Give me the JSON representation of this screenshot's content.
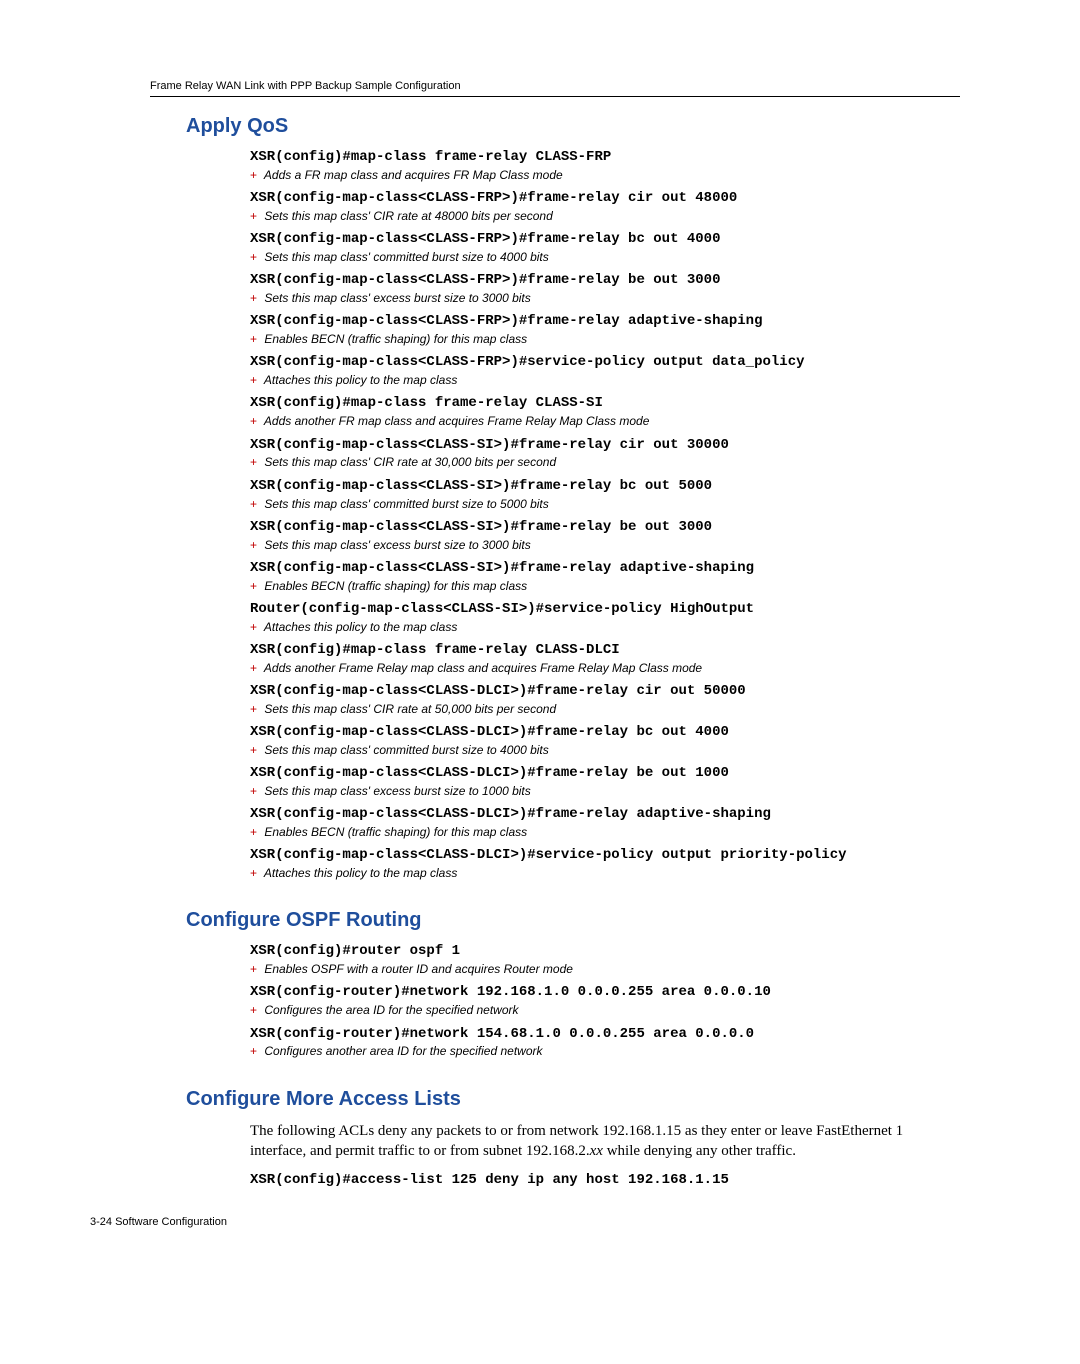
{
  "runner": "Frame Relay WAN Link with PPP Backup Sample Configuration",
  "sections": {
    "qos": {
      "title": "Apply QoS",
      "items": [
        {
          "cmd": "XSR(config)#map-class frame-relay CLASS-FRP",
          "anno": "Adds a FR map class and acquires FR Map Class mode"
        },
        {
          "cmd": "XSR(config-map-class<CLASS-FRP>)#frame-relay cir out 48000",
          "anno": "Sets this map class' CIR rate at 48000 bits per second"
        },
        {
          "cmd": "XSR(config-map-class<CLASS-FRP>)#frame-relay bc out 4000",
          "anno": "Sets this map class' committed burst size to 4000 bits"
        },
        {
          "cmd": "XSR(config-map-class<CLASS-FRP>)#frame-relay be out 3000",
          "anno": "Sets this map class' excess burst size to 3000 bits"
        },
        {
          "cmd": "XSR(config-map-class<CLASS-FRP>)#frame-relay adaptive-shaping",
          "anno": "Enables BECN (traffic shaping) for this map class"
        },
        {
          "cmd": "XSR(config-map-class<CLASS-FRP>)#service-policy output data_policy",
          "anno": "Attaches this policy to the map class"
        },
        {
          "cmd": "XSR(config)#map-class frame-relay CLASS-SI",
          "anno": "Adds another FR map class and acquires Frame Relay Map Class mode"
        },
        {
          "cmd": "XSR(config-map-class<CLASS-SI>)#frame-relay cir out 30000",
          "anno": "Sets this map class' CIR rate at 30,000 bits per second"
        },
        {
          "cmd": "XSR(config-map-class<CLASS-SI>)#frame-relay bc out 5000",
          "anno": "Sets this map class' committed burst size to 5000 bits"
        },
        {
          "cmd": "XSR(config-map-class<CLASS-SI>)#frame-relay be out 3000",
          "anno": "Sets this map class' excess burst size to 3000 bits"
        },
        {
          "cmd": "XSR(config-map-class<CLASS-SI>)#frame-relay adaptive-shaping",
          "anno": "Enables BECN (traffic shaping) for this map class"
        },
        {
          "cmd": "Router(config-map-class<CLASS-SI>)#service-policy HighOutput",
          "anno": "Attaches this policy to the map class"
        },
        {
          "cmd": "XSR(config)#map-class frame-relay CLASS-DLCI",
          "anno": "Adds another Frame Relay map class and acquires Frame Relay Map Class mode"
        },
        {
          "cmd": "XSR(config-map-class<CLASS-DLCI>)#frame-relay cir out 50000",
          "anno": "Sets this map class' CIR rate at 50,000 bits per second"
        },
        {
          "cmd": "XSR(config-map-class<CLASS-DLCI>)#frame-relay bc out 4000",
          "anno": "Sets this map class' committed burst size to 4000 bits"
        },
        {
          "cmd": "XSR(config-map-class<CLASS-DLCI>)#frame-relay be out 1000",
          "anno": "Sets this map class' excess burst size to 1000 bits"
        },
        {
          "cmd": "XSR(config-map-class<CLASS-DLCI>)#frame-relay adaptive-shaping",
          "anno": "Enables BECN (traffic shaping) for this map class"
        },
        {
          "cmd": "XSR(config-map-class<CLASS-DLCI>)#service-policy output priority-policy",
          "anno": "Attaches this policy to the map class"
        }
      ]
    },
    "ospf": {
      "title": "Configure OSPF Routing",
      "items": [
        {
          "cmd": "XSR(config)#router ospf 1",
          "anno": "Enables OSPF with a router ID and acquires Router mode"
        },
        {
          "cmd": "XSR(config-router)#network 192.168.1.0 0.0.0.255 area 0.0.0.10",
          "anno": "Configures the area ID for the specified network"
        },
        {
          "cmd": "XSR(config-router)#network 154.68.1.0 0.0.0.255 area 0.0.0.0",
          "anno": "Configures another area ID for the specified network"
        }
      ]
    },
    "acl": {
      "title": "Configure More Access Lists",
      "body_pre": "The following ACLs deny any packets to or from network 192.168.1.15 as they enter or leave FastEthernet 1 interface, and permit traffic to or from subnet 192.168.2.",
      "body_italic": "xx",
      "body_post": " while denying any other traffic.",
      "cmd": "XSR(config)#access-list 125 deny ip any host 192.168.1.15"
    }
  },
  "footer": "3-24   Software Configuration"
}
